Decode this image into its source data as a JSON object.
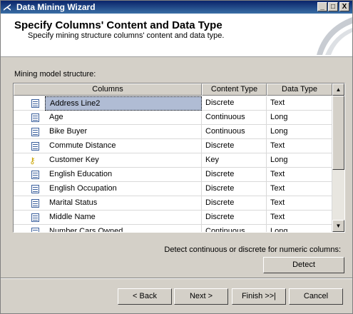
{
  "window": {
    "title": "Data Mining Wizard",
    "controls": {
      "minimize": "_",
      "maximize": "□",
      "close": "X"
    }
  },
  "header": {
    "title": "Specify Columns' Content and Data Type",
    "subtitle": "Specify mining structure columns' content and data type."
  },
  "structure": {
    "label": "Mining model structure:",
    "columns": [
      "Columns",
      "Content Type",
      "Data Type"
    ],
    "rows": [
      {
        "icon": "column-icon",
        "name": "Address Line2",
        "content_type": "Discrete",
        "data_type": "Text",
        "selected": true
      },
      {
        "icon": "column-icon",
        "name": "Age",
        "content_type": "Continuous",
        "data_type": "Long"
      },
      {
        "icon": "column-icon",
        "name": "Bike Buyer",
        "content_type": "Continuous",
        "data_type": "Long"
      },
      {
        "icon": "column-icon",
        "name": "Commute Distance",
        "content_type": "Discrete",
        "data_type": "Text"
      },
      {
        "icon": "key-column-icon",
        "name": "Customer Key",
        "content_type": "Key",
        "data_type": "Long"
      },
      {
        "icon": "column-icon",
        "name": "English Education",
        "content_type": "Discrete",
        "data_type": "Text"
      },
      {
        "icon": "column-icon",
        "name": "English Occupation",
        "content_type": "Discrete",
        "data_type": "Text"
      },
      {
        "icon": "column-icon",
        "name": "Marital Status",
        "content_type": "Discrete",
        "data_type": "Text"
      },
      {
        "icon": "column-icon",
        "name": "Middle Name",
        "content_type": "Discrete",
        "data_type": "Text"
      },
      {
        "icon": "column-icon",
        "name": "Number Cars Owned",
        "content_type": "Continuous",
        "data_type": "Long"
      }
    ]
  },
  "detect": {
    "label": "Detect continuous or discrete for numeric columns:",
    "button": "Detect"
  },
  "footer": {
    "back": "< Back",
    "next": "Next >",
    "finish": "Finish >>|",
    "cancel": "Cancel"
  }
}
